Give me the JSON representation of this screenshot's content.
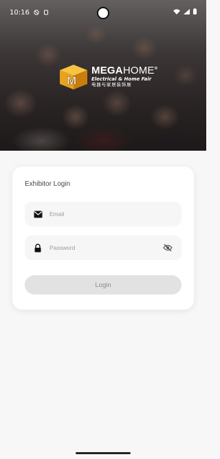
{
  "status_bar": {
    "time": "10:16",
    "icons": [
      "do-not-disturb-icon",
      "notification-icon",
      "wifi-icon",
      "signal-icon",
      "battery-icon"
    ]
  },
  "logo": {
    "brand_part1": "MEGA",
    "brand_part2": "HOME",
    "registered": "®",
    "subtitle": "Electrical & Home Fair",
    "chinese": "电器与家居装饰展",
    "cube_letter": "M"
  },
  "login": {
    "title": "Exhibitor Login",
    "email_placeholder": "Email",
    "password_placeholder": "Password",
    "button_label": "Login"
  },
  "colors": {
    "accent_gold": "#e8a21c",
    "card_bg": "#ffffff",
    "field_bg": "#f6f6f6",
    "button_bg": "#e2e2e2",
    "button_text": "#8a8a8a"
  }
}
